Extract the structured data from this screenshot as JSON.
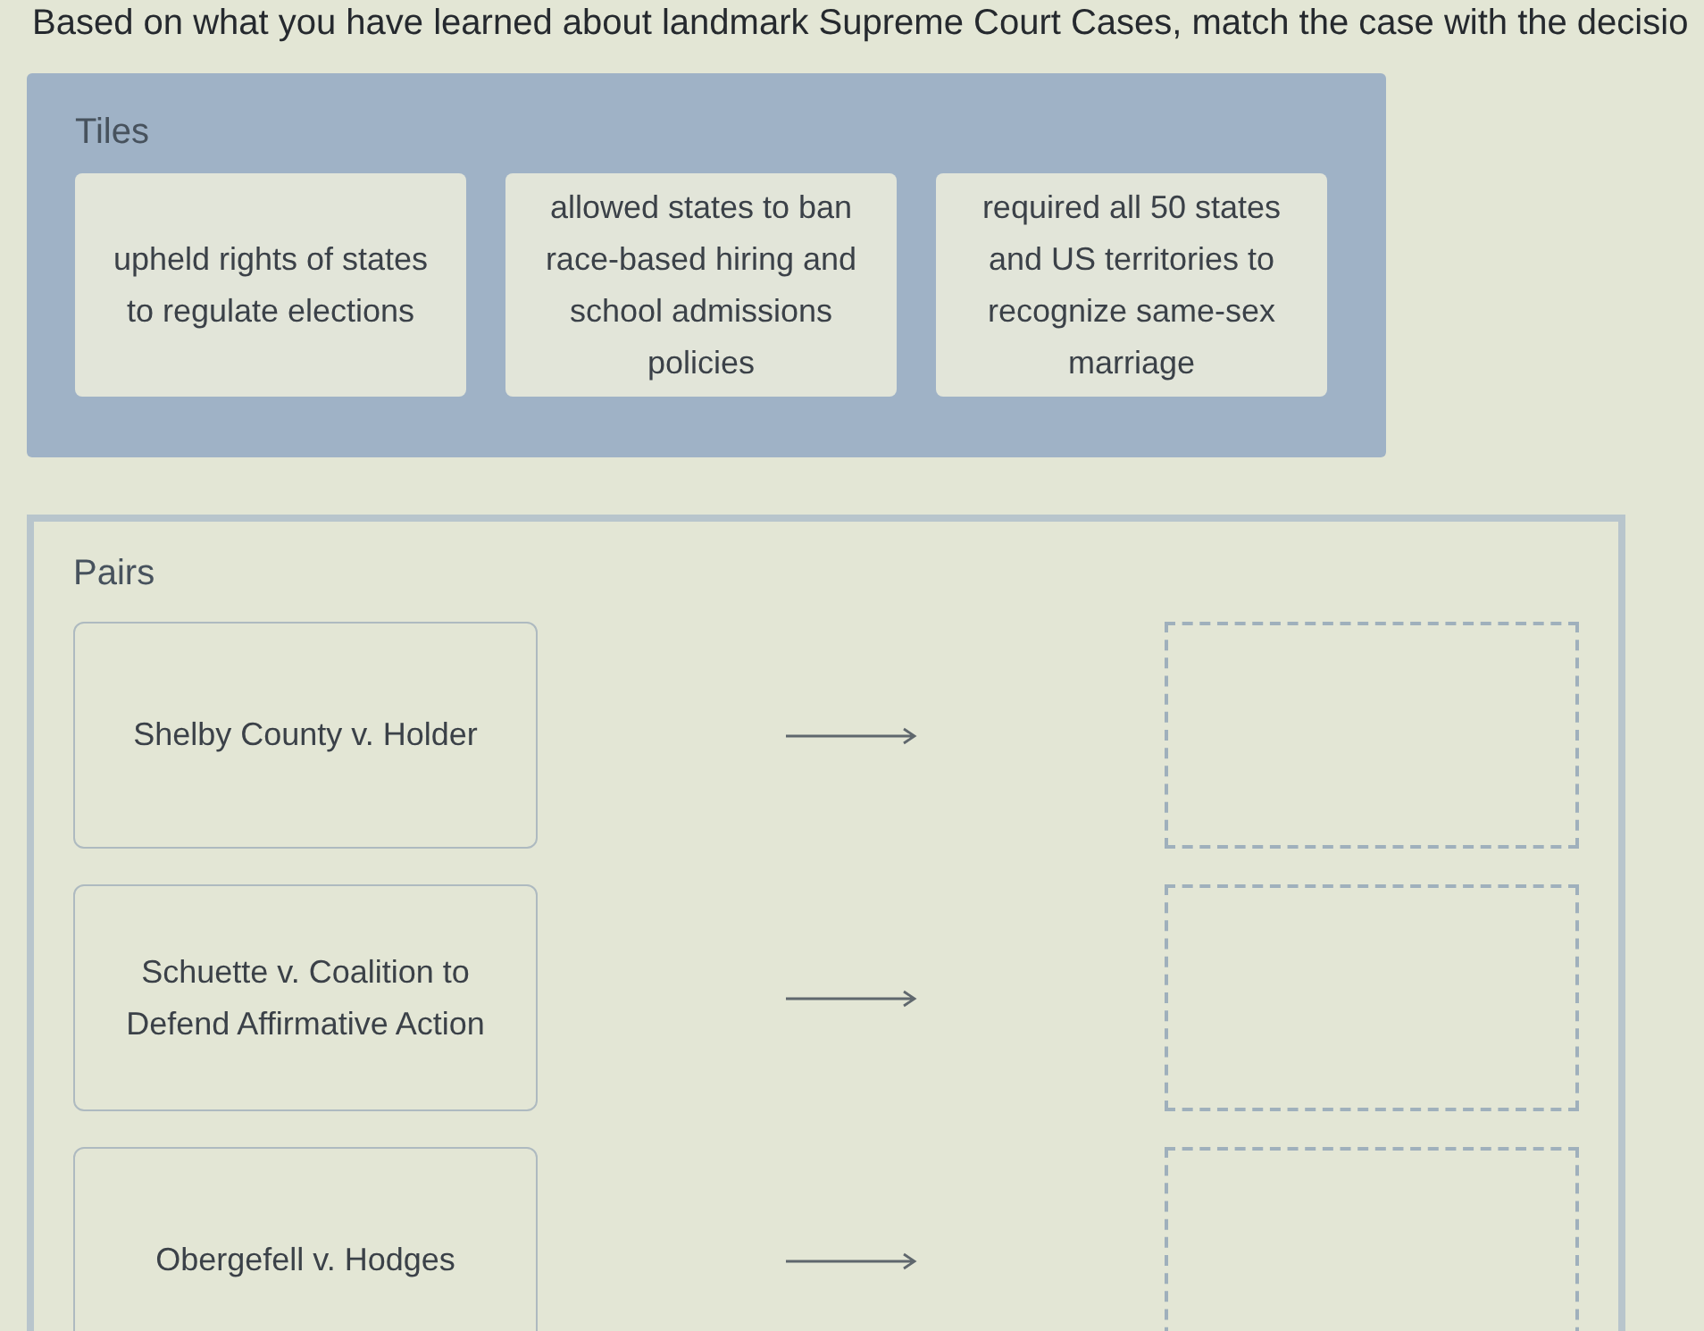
{
  "instruction": "Based on what you have learned about landmark Supreme Court Cases, match the case with the decisio",
  "tiles_panel": {
    "title": "Tiles",
    "tiles": [
      {
        "text": "upheld rights of states to regulate elections"
      },
      {
        "text": "allowed states to ban race-based hiring and school admissions policies"
      },
      {
        "text": "required all 50 states and US territories to recognize same-sex marriage"
      }
    ]
  },
  "pairs_panel": {
    "title": "Pairs",
    "pairs": [
      {
        "case": "Shelby County v. Holder"
      },
      {
        "case": "Schuette v. Coalition to Defend Affirmative Action"
      },
      {
        "case": "Obergefell v. Hodges"
      }
    ]
  }
}
